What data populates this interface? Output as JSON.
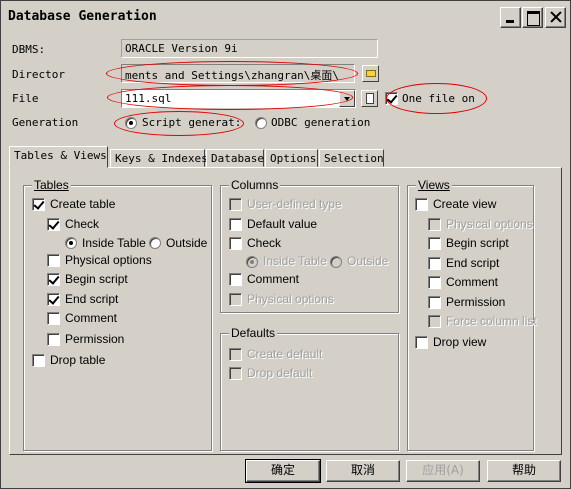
{
  "window": {
    "title": "Database Generation"
  },
  "form": {
    "dbms_label": "DBMS:",
    "dbms_value": "ORACLE Version 9i",
    "directory_label": "Director",
    "directory_value": "ments and Settings\\zhangran\\桌面\\",
    "file_label": "File",
    "file_value": "111.sql",
    "one_file_on": {
      "label": "One file on",
      "checked": true
    },
    "generation_label": "Generation",
    "script_generation": {
      "label": "Script generat:",
      "selected": true
    },
    "odbc_generation": {
      "label": "ODBC generation",
      "selected": false
    }
  },
  "tabs": [
    {
      "label": "Tables & Views",
      "active": true
    },
    {
      "label": "Keys & Indexes",
      "active": false
    },
    {
      "label": "Database",
      "active": false
    },
    {
      "label": "Options",
      "active": false
    },
    {
      "label": "Selection",
      "active": false
    }
  ],
  "tables_group": {
    "title": "Tables",
    "create_table": "Create table",
    "check": "Check",
    "inside_table": "Inside Table",
    "outside": "Outside",
    "physical_options": "Physical options",
    "begin_script": "Begin script",
    "end_script": "End script",
    "comment": "Comment",
    "permission": "Permission",
    "drop_table": "Drop table"
  },
  "columns_group": {
    "title": "Columns",
    "user_defined_type": "User-defined type",
    "default_value": "Default value",
    "check": "Check",
    "inside_table": "Inside Table",
    "outside": "Outside",
    "comment": "Comment",
    "physical_options": "Physical options"
  },
  "defaults_group": {
    "title": "Defaults",
    "create_default": "Create default",
    "drop_default": "Drop default"
  },
  "views_group": {
    "title": "Views",
    "create_view": "Create view",
    "physical_options": "Physical options",
    "begin_script": "Begin script",
    "end_script": "End script",
    "comment": "Comment",
    "permission": "Permission",
    "force_column_list": "Force column list",
    "drop_view": "Drop view"
  },
  "buttons": {
    "ok": "确定",
    "cancel": "取消",
    "apply": "应用(A)",
    "help": "帮助"
  },
  "colors": {
    "face": "#d4d0c8",
    "annotation": "#e00000",
    "disabled_text": "#a0a0a0"
  }
}
